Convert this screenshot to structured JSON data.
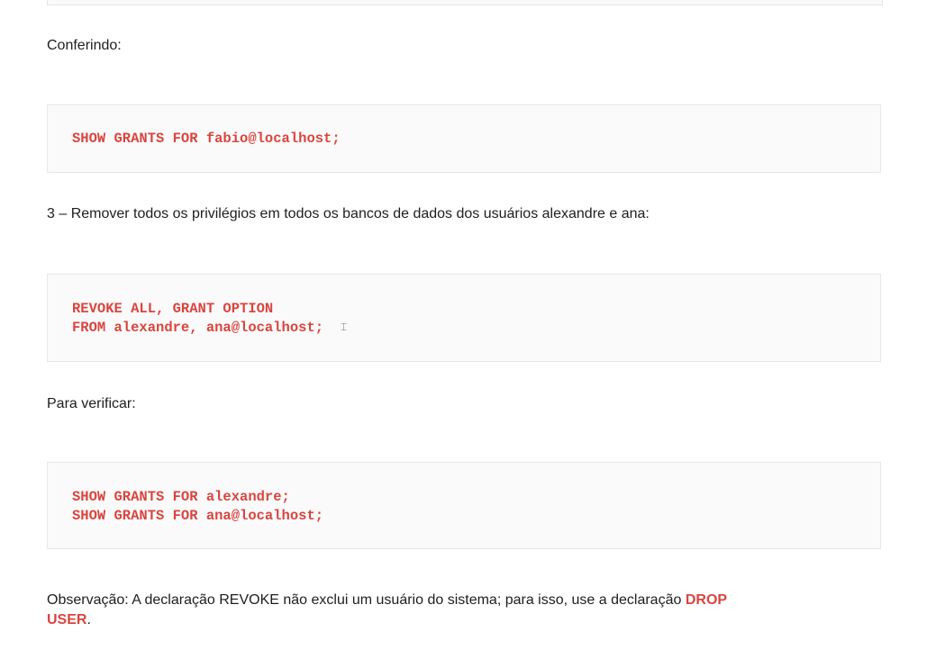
{
  "paragraphs": {
    "checking": "Conferindo:",
    "step3": "3 – Remover todos os privilégios em todos os bancos de dados dos usuários alexandre e ana:",
    "verify": "Para verificar:",
    "note_prefix": "Observação: A declaração REVOKE não exclui um usuário do sistema; para isso, use a declaração ",
    "note_strong_1": "DROP",
    "note_strong_2": "USER",
    "note_suffix": "."
  },
  "code_blocks": [
    {
      "lines": [
        "SHOW GRANTS FOR fabio@localhost;"
      ]
    },
    {
      "lines": [
        "REVOKE ALL, GRANT OPTION",
        "FROM alexandre, ana@localhost;"
      ]
    },
    {
      "lines": [
        "SHOW GRANTS FOR alexandre;",
        "SHOW GRANTS FOR ana@localhost;"
      ]
    }
  ],
  "colors": {
    "code_text": "#d9453f",
    "body_text": "#1e1e1e",
    "code_background": "#fafafa",
    "code_border": "#e8e8e8"
  }
}
